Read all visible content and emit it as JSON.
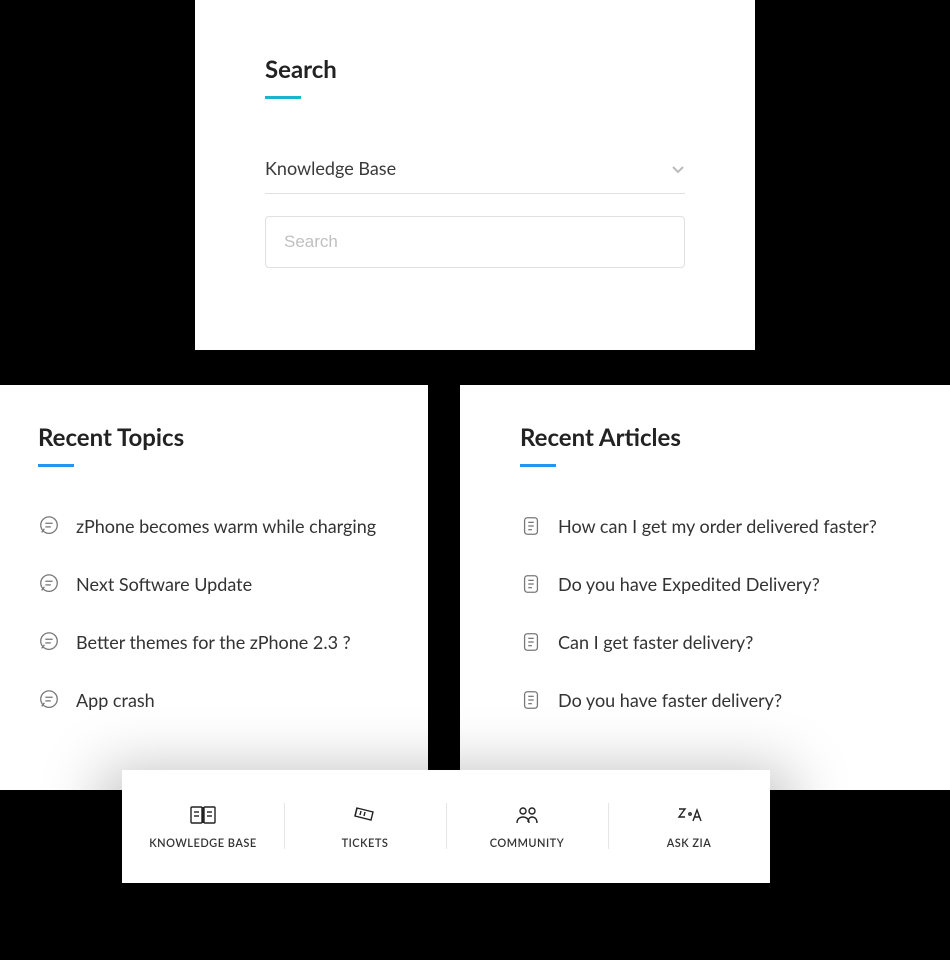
{
  "search": {
    "title": "Search",
    "scope_label": "Knowledge Base",
    "placeholder": "Search"
  },
  "recent_topics": {
    "title": "Recent Topics",
    "items": [
      "zPhone becomes warm while charging",
      "Next Software Update",
      "Better themes for the zPhone 2.3 ?",
      "App crash"
    ]
  },
  "recent_articles": {
    "title": "Recent Articles",
    "items": [
      "How can I get my order delivered faster?",
      "Do you have Expedited Delivery?",
      "Can I get faster delivery?",
      "Do you have faster delivery?"
    ]
  },
  "nav": {
    "items": [
      {
        "id": "knowledge-base",
        "label": "KNOWLEDGE BASE"
      },
      {
        "id": "tickets",
        "label": "TICKETS"
      },
      {
        "id": "community",
        "label": "COMMUNITY"
      },
      {
        "id": "ask-zia",
        "label": "ASK ZIA"
      }
    ]
  }
}
